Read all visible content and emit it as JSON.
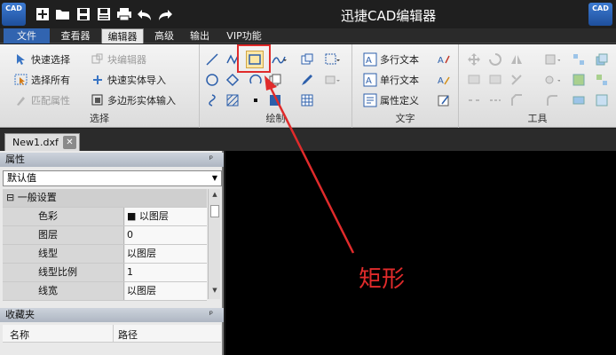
{
  "app": {
    "title": "迅捷CAD编辑器",
    "logo_text": "CAD"
  },
  "quick_access": [
    "new-icon",
    "open-icon",
    "save-icon",
    "save-as-icon",
    "print-icon",
    "undo-icon",
    "redo-icon"
  ],
  "menu": {
    "tabs": [
      "文件",
      "查看器",
      "编辑器",
      "高级",
      "输出",
      "VIP功能"
    ],
    "active": "编辑器"
  },
  "ribbon": {
    "select_group": {
      "label": "选择",
      "quick_select": "快速选择",
      "block_editor": "块编辑器",
      "select_all": "选择所有",
      "quick_entity_import": "快速实体导入",
      "match_properties": "匹配属性",
      "polygon_entity_input": "多边形实体输入"
    },
    "draw_group": {
      "label": "绘制"
    },
    "text_group": {
      "label": "文字",
      "mtext": "多行文本",
      "single_text": "单行文本",
      "attribute_define": "属性定义"
    },
    "tools_group": {
      "label": "工具"
    }
  },
  "document": {
    "tab_label": "New1.dxf"
  },
  "properties_panel": {
    "title": "属性",
    "pin": "ᵖ",
    "filter_value": "默认值",
    "section": "一般设置",
    "rows": [
      {
        "key": "色彩",
        "value": "■ 以图层"
      },
      {
        "key": "图层",
        "value": "0"
      },
      {
        "key": "线型",
        "value": "以图层"
      },
      {
        "key": "线型比例",
        "value": "1"
      },
      {
        "key": "线宽",
        "value": "以图层"
      }
    ]
  },
  "favorites_panel": {
    "title": "收藏夹",
    "col_name": "名称",
    "col_path": "路径"
  },
  "annotation": {
    "label": "矩形",
    "color": "#e02b2b"
  },
  "colors": {
    "file_tab": "#3164b0",
    "canvas": "#000000",
    "highlight": "#e02b2b"
  }
}
